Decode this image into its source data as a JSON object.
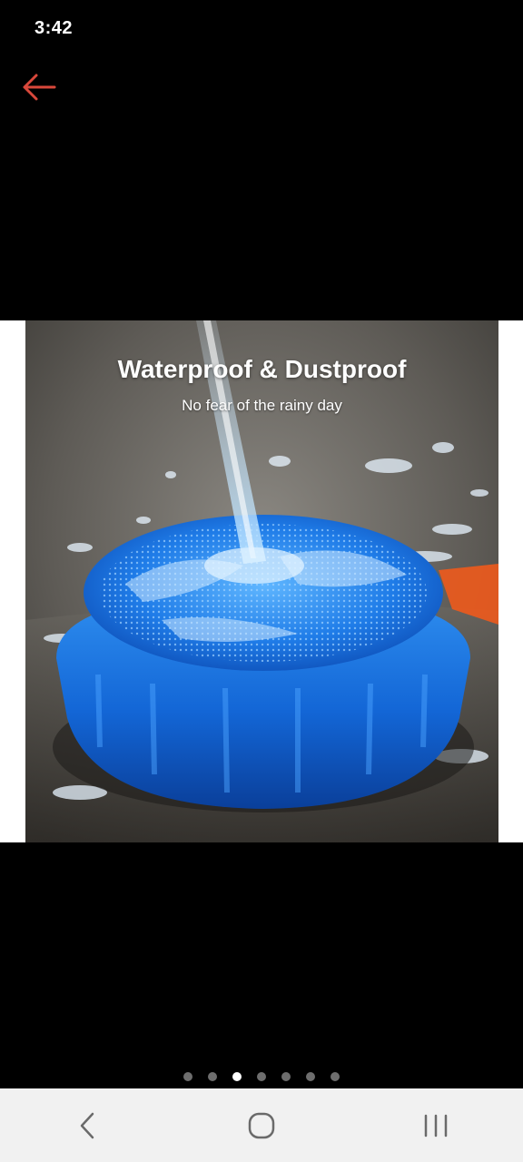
{
  "status_bar": {
    "time": "3:42"
  },
  "header": {
    "back_icon": "arrow-left-icon",
    "accent_color": "#d9483b"
  },
  "product_image": {
    "title": "Waterproof & Dustproof",
    "subtitle": "No fear of the rainy day"
  },
  "pager": {
    "total": 7,
    "active_index": 2
  },
  "nav_bar": {
    "back_icon": "chevron-left-icon",
    "home_icon": "home-circle-icon",
    "recents_icon": "recents-lines-icon"
  }
}
